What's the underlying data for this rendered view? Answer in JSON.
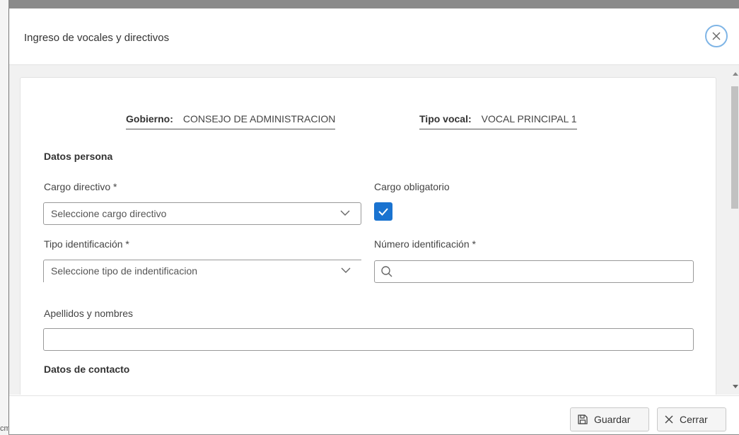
{
  "background": {
    "partial_text": "cmo tito"
  },
  "dialog": {
    "title": "Ingreso de vocales y directivos",
    "close_icon": "close-icon"
  },
  "info": {
    "gobierno_label": "Gobierno:",
    "gobierno_value": "CONSEJO DE ADMINISTRACION",
    "tipo_vocal_label": "Tipo vocal:",
    "tipo_vocal_value": "VOCAL PRINCIPAL 1"
  },
  "datos_persona": {
    "title": "Datos persona",
    "cargo_directivo": {
      "label": "Cargo directivo *",
      "placeholder": "Seleccione cargo directivo"
    },
    "cargo_obligatorio": {
      "label": "Cargo obligatorio",
      "checked": true
    },
    "tipo_identificacion": {
      "label": "Tipo identificación *",
      "placeholder": "Seleccione tipo de indentificacion"
    },
    "numero_identificacion": {
      "label": "Número identificación *",
      "value": ""
    },
    "apellidos_nombres": {
      "label": "Apellidos y nombres",
      "value": ""
    }
  },
  "datos_contacto": {
    "title": "Datos de contacto"
  },
  "footer": {
    "save_label": "Guardar",
    "close_label": "Cerrar"
  },
  "colors": {
    "accent": "#1a73d0",
    "close_ring": "#7fb5e6"
  }
}
